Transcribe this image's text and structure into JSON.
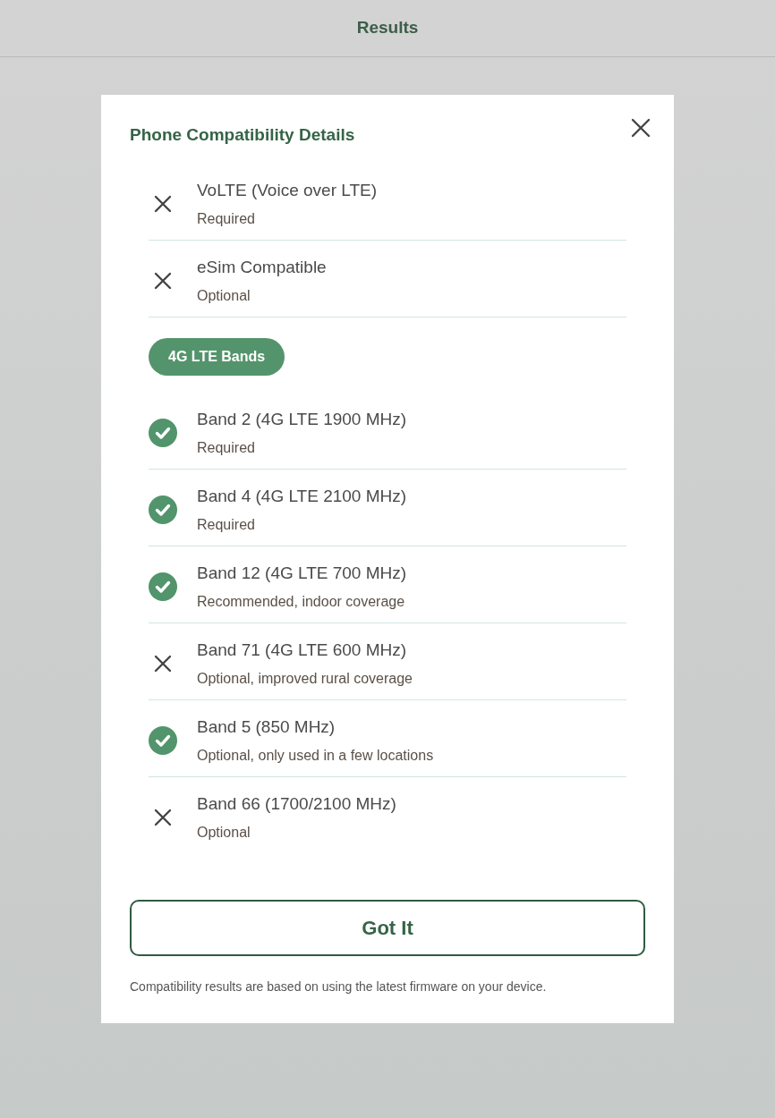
{
  "header": {
    "title": "Results"
  },
  "dialog": {
    "title": "Phone Compatibility Details",
    "features": [
      {
        "name": "VoLTE (Voice over LTE)",
        "note": "Required",
        "supported": false
      },
      {
        "name": "eSim Compatible",
        "note": "Optional",
        "supported": false
      }
    ],
    "section_label": "4G LTE Bands",
    "bands": [
      {
        "name": "Band 2 (4G LTE 1900 MHz)",
        "note": "Required",
        "supported": true
      },
      {
        "name": "Band 4 (4G LTE 2100 MHz)",
        "note": "Required",
        "supported": true
      },
      {
        "name": "Band 12 (4G LTE 700 MHz)",
        "note": "Recommended, indoor coverage",
        "supported": true
      },
      {
        "name": "Band 71 (4G LTE 600 MHz)",
        "note": "Optional, improved rural coverage",
        "supported": false
      },
      {
        "name": "Band 5 (850 MHz)",
        "note": "Optional, only used in a few locations",
        "supported": true
      },
      {
        "name": "Band 66 (1700/2100 MHz)",
        "note": "Optional",
        "supported": false
      }
    ],
    "button": "Got It",
    "footnote": "Compatibility results are based on using the latest firmware on your device."
  }
}
